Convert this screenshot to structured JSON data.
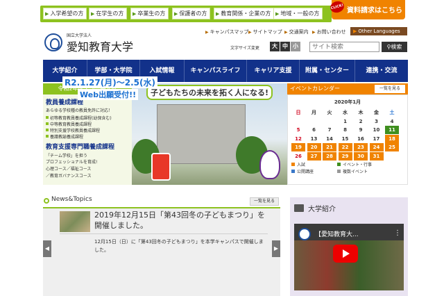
{
  "audience_tabs": [
    {
      "label": "入学希望の方"
    },
    {
      "label": "在学生の方"
    },
    {
      "label": "卒業生の方"
    },
    {
      "label": "保護者の方"
    },
    {
      "label": "教育関係・企業の方"
    },
    {
      "label": "地域・一般の方"
    }
  ],
  "request": {
    "badge": "CLICK!",
    "label": "資料請求はこちら"
  },
  "header": {
    "corp_label": "国立大学法人",
    "univ_name": "愛知教育大学",
    "utility_links": [
      "キャンパスマップ",
      "サイトマップ",
      "交通案内",
      "お問い合わせ"
    ],
    "other_languages": "Other Languages",
    "font_size_label": "文字サイズ変更",
    "font_sizes": [
      "大",
      "中",
      "小"
    ],
    "search_placeholder": "サイト検索",
    "search_button": "検索"
  },
  "nav": {
    "items": [
      "大学紹介",
      "学部・大学院",
      "入試情報",
      "キャンパスライフ",
      "キャリア支援",
      "附属・センター",
      "連携・交流"
    ]
  },
  "admission": {
    "header": "令和2年度学部一般入試",
    "course1_title": "教員養成課程",
    "course1_desc": "あらゆる学校種の教員免許に対応！",
    "course1_items": [
      "初等教育教員養成課程(幼保含む)",
      "中等教育教員養成課程",
      "特別支援学校教員養成課程",
      "養護教諭養成課程"
    ],
    "course2_title": "教育支援専門職養成課程",
    "course2_desc1": "「チーム学校」を担う",
    "course2_desc2": "プロフェッショナルを育成!",
    "course2_desc3": "心理コース／福祉コース",
    "course2_desc4": "／教育ガバナンスコース"
  },
  "hero": {
    "banner": "子どもたちの未来を拓く人になる!",
    "dates": "R2.1.27(月)～2.5(水)",
    "web": "Web出願受付!!"
  },
  "calendar": {
    "title": "イベントカレンダー",
    "more": "一覧を見る",
    "month": "2020年1月",
    "weekdays": [
      "日",
      "月",
      "火",
      "水",
      "木",
      "金",
      "土"
    ],
    "days": [
      [
        "",
        "",
        "",
        "1",
        "2",
        "3",
        "4"
      ],
      [
        "5",
        "6",
        "7",
        "8",
        "9",
        "10",
        "11"
      ],
      [
        "12",
        "13",
        "14",
        "15",
        "16",
        "17",
        "18"
      ],
      [
        "19",
        "20",
        "21",
        "22",
        "23",
        "24",
        "25"
      ],
      [
        "26",
        "27",
        "28",
        "29",
        "30",
        "31",
        ""
      ]
    ],
    "legend": [
      "入試",
      "イベント・行事",
      "公開講座",
      "複数イベント"
    ],
    "colors": {
      "entrance_exam": "#f08300",
      "event": "#3f8f1f",
      "lecture": "#3a78c8",
      "multi": "#999999",
      "sunday": "#d0021b",
      "saturday": "#1f6fd0"
    }
  },
  "news": {
    "heading": "News&Topics",
    "more": "一覧を見る",
    "title": "2019年12月15日「第43回冬の子どもまつり」を開催しました。",
    "text": "12月15日（日）に「第43回冬の子どもまつり」を本学キャンパスで開催しました。"
  },
  "intro": {
    "title": "大学紹介",
    "video_title": "【愛知教育大..."
  }
}
